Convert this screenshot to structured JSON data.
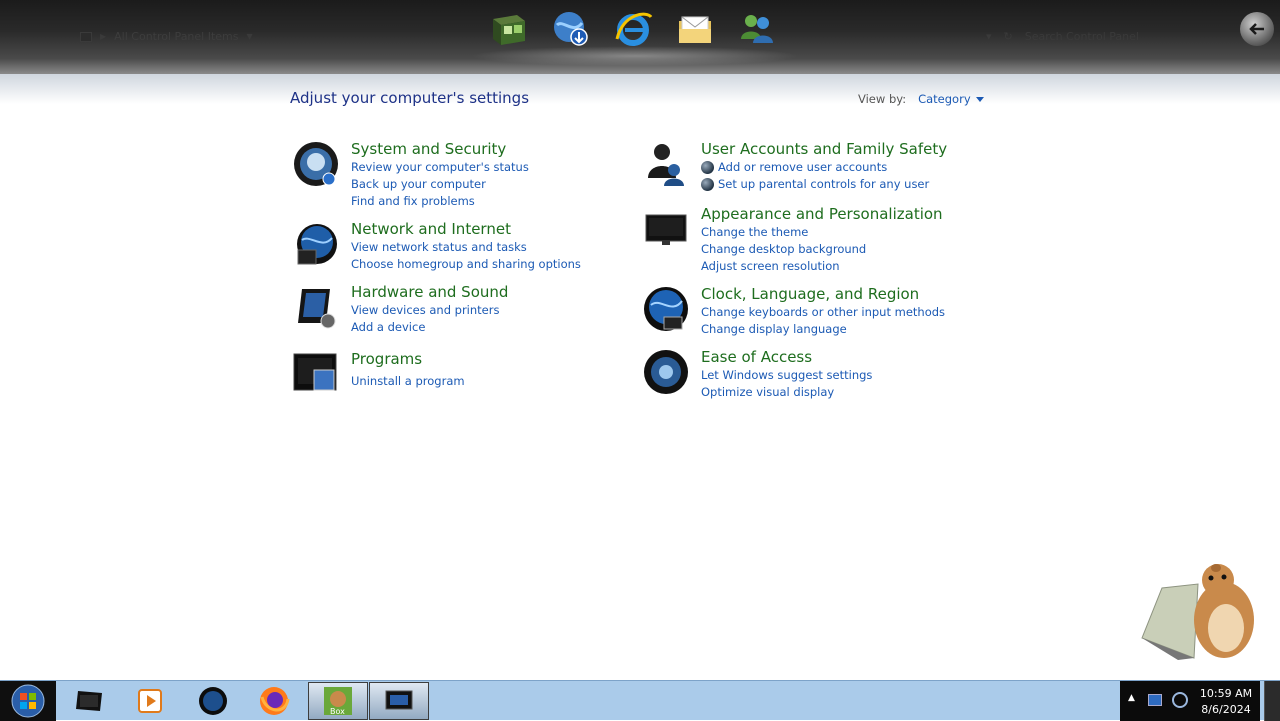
{
  "header": {
    "breadcrumb_text": "All Control Panel Items",
    "search_placeholder": "Search Control Panel",
    "dock_icons": [
      "display-icon",
      "globe-download-icon",
      "internet-explorer-icon",
      "mail-folder-icon",
      "user-network-icon"
    ]
  },
  "main": {
    "title": "Adjust your computer's settings",
    "view_by_label": "View by:",
    "view_by_value": "Category",
    "categories": [
      {
        "title": "System and Security",
        "links": [
          "Review your computer's status",
          "Back up your computer",
          "Find and fix problems"
        ]
      },
      {
        "title": "Network and Internet",
        "links": [
          "View network status and tasks",
          "Choose homegroup and sharing options"
        ]
      },
      {
        "title": "Hardware and Sound",
        "links": [
          "View devices and printers",
          "Add a device"
        ]
      },
      {
        "title": "Programs",
        "links": [
          "Uninstall a program"
        ]
      },
      {
        "title": "User Accounts and Family Safety",
        "links": [
          "Add or remove user accounts",
          "Set up parental controls for any user"
        ]
      },
      {
        "title": "Appearance and Personalization",
        "links": [
          "Change the theme",
          "Change desktop background",
          "Adjust screen resolution"
        ]
      },
      {
        "title": "Clock, Language, and Region",
        "links": [
          "Change keyboards or other input methods",
          "Change display language"
        ]
      },
      {
        "title": "Ease of Access",
        "links": [
          "Let Windows suggest settings",
          "Optimize visual display"
        ]
      }
    ]
  },
  "taskbar": {
    "items": [
      "monitor-icon",
      "media-player-icon",
      "globe-icon",
      "firefox-icon",
      "box-app-icon",
      "control-panel-icon"
    ],
    "time": "10:59 AM",
    "date": "8/6/2024"
  }
}
